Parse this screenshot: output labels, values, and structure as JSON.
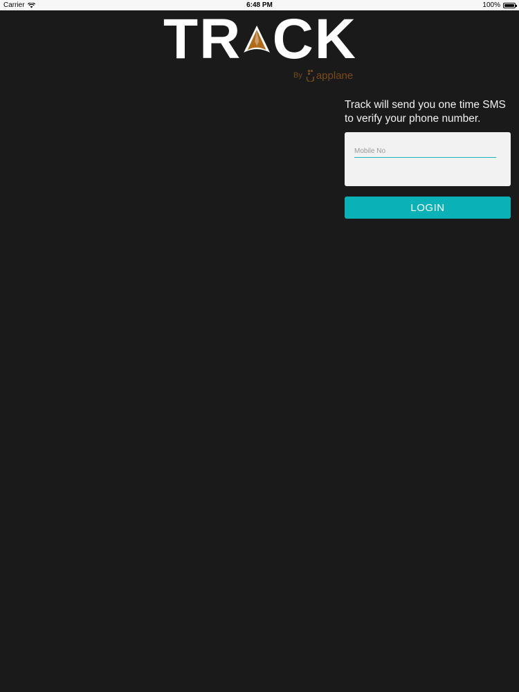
{
  "status_bar": {
    "carrier": "Carrier",
    "time": "6:48 PM",
    "battery": "100%",
    "battery_level": 1.0
  },
  "logo": {
    "left": "TR",
    "right": "CK",
    "by": "By",
    "brand": "applane",
    "accent_color": "#b06a1c"
  },
  "login": {
    "info": "Track will send you one time SMS to verify your phone number.",
    "mobile_placeholder": "Mobile No",
    "button_label": "LOGIN",
    "button_color": "#0ab2b8"
  },
  "icons": [
    "wifi-icon",
    "battery-icon",
    "track-a-logo-icon",
    "applane-logo-icon"
  ]
}
